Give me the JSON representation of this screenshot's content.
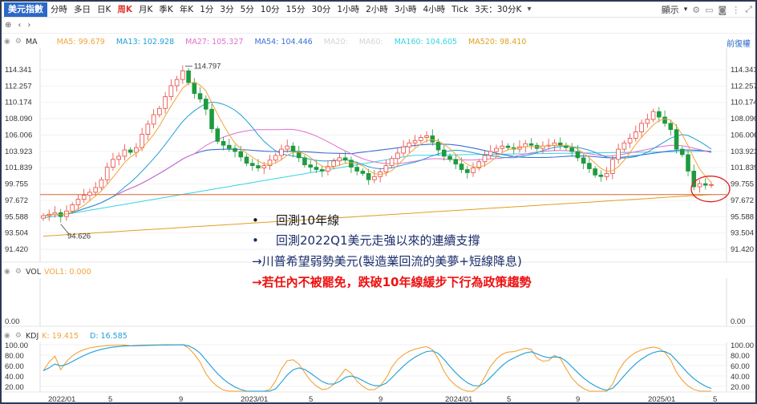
{
  "toolbar": {
    "title": "美元指數",
    "intervals": [
      "分時",
      "多日",
      "日K",
      "周K",
      "月K",
      "季K",
      "年K",
      "1分",
      "3分",
      "5分",
      "10分",
      "15分",
      "30分",
      "1小時",
      "2小時",
      "3小時",
      "4小時",
      "Tick",
      "3天：30分K"
    ],
    "active_interval": "周K",
    "display_label": "顯示"
  },
  "ma_bar": {
    "label": "MA",
    "items": [
      {
        "text": "MA5: 99.679",
        "color": "#f2a33a"
      },
      {
        "text": "MA13: 102.928",
        "color": "#1e9fd8"
      },
      {
        "text": "MA27: 105.327",
        "color": "#e06fd0"
      },
      {
        "text": "MA54: 104.446",
        "color": "#3d6fd4"
      },
      {
        "text": "MA20:",
        "color": "#d4d4d4"
      },
      {
        "text": "MA60:",
        "color": "#d4d4d4"
      },
      {
        "text": "MA160: 104.605",
        "color": "#36d3e3"
      },
      {
        "text": "MA520: 98.410",
        "color": "#e0a020"
      }
    ],
    "right_link": "前復權"
  },
  "vol_bar": {
    "label": "VOL",
    "items": [
      {
        "text": "VOL1: 0.000",
        "color": "#f2a33a"
      }
    ]
  },
  "kdj_bar": {
    "label": "KDJ",
    "items": [
      {
        "text": "K: 19.415",
        "color": "#f2a33a"
      },
      {
        "text": "D: 16.585",
        "color": "#1e9fd8"
      }
    ]
  },
  "annotations": {
    "line1": "回測10年線",
    "line2": "回測2022Q1美元走強以來的連續支撐",
    "line3": "→川普希望弱勢美元(製造業回流的美夢+短線降息)",
    "line4": "→若任內不被罷免，跌破10年線緩步下行為政策趨勢"
  },
  "chart_data": {
    "type": "line",
    "title": "",
    "price_axis": {
      "ticks_left": [
        "114.341",
        "112.257",
        "110.174",
        "108.090",
        "106.006",
        "103.923",
        "101.839",
        "99.755",
        "97.672",
        "95.588",
        "93.504",
        "91.420"
      ],
      "ticks_right": [
        "114.341",
        "112.257",
        "110.174",
        "108.090",
        "106.006",
        "103.923",
        "101.839",
        "99.755",
        "97.672",
        "95.588",
        "93.504",
        "91.420"
      ],
      "range": [
        91.42,
        114.341
      ]
    },
    "max_label": "114.797",
    "min_label": "94.626",
    "x_ticks": [
      "2022/01",
      "5",
      "9",
      "2023/01",
      "5",
      "9",
      "2024/01",
      "5",
      "9",
      "2025/01",
      "5"
    ],
    "weekly_close": [
      95.7,
      95.9,
      96.1,
      95.6,
      96.3,
      97.1,
      97.8,
      98.3,
      98.7,
      99.3,
      100.3,
      101.9,
      102.9,
      103.3,
      104.1,
      103.8,
      104.4,
      106.1,
      107.4,
      108.6,
      109.4,
      110.9,
      112.3,
      113.1,
      114.2,
      112.7,
      111.3,
      110.6,
      109.3,
      106.8,
      105.2,
      104.7,
      104.3,
      103.9,
      103.2,
      102.4,
      102.1,
      101.8,
      102.1,
      102.8,
      103.4,
      104.2,
      104.6,
      103.9,
      103.1,
      102.2,
      101.9,
      101.6,
      101.4,
      102.0,
      102.7,
      103.1,
      102.8,
      101.9,
      101.4,
      101.1,
      100.3,
      100.7,
      101.3,
      102.1,
      103.0,
      103.7,
      104.5,
      105.0,
      105.3,
      105.7,
      105.9,
      105.1,
      104.1,
      103.3,
      102.9,
      102.3,
      101.6,
      101.2,
      101.8,
      102.6,
      103.4,
      103.9,
      104.3,
      104.6,
      104.4,
      104.2,
      104.5,
      104.9,
      104.7,
      104.3,
      104.6,
      104.7,
      105.0,
      104.7,
      104.4,
      103.9,
      103.1,
      102.4,
      101.7,
      100.9,
      100.7,
      101.1,
      102.9,
      104.2,
      105.0,
      105.6,
      106.4,
      107.5,
      108.0,
      109.0,
      108.3,
      107.5,
      106.7,
      104.2,
      103.5,
      101.4,
      99.4,
      99.8,
      99.6,
      99.68
    ],
    "overlay_levels": {
      "ten_year_line": 98.41
    },
    "series": [
      {
        "name": "MA5",
        "color": "#f2a33a"
      },
      {
        "name": "MA13",
        "color": "#1e9fd8"
      },
      {
        "name": "MA27",
        "color": "#e06fd0"
      },
      {
        "name": "MA54",
        "color": "#3d6fd4"
      },
      {
        "name": "MA160",
        "color": "#36d3e3"
      },
      {
        "name": "MA520",
        "color": "#e0a020"
      }
    ],
    "vol_axis": {
      "ticks": [
        "0.00"
      ]
    },
    "kdj_axis": {
      "ticks": [
        "100.00",
        "80.00",
        "60.00",
        "40.00",
        "20.00"
      ],
      "range": [
        0,
        110
      ]
    }
  }
}
